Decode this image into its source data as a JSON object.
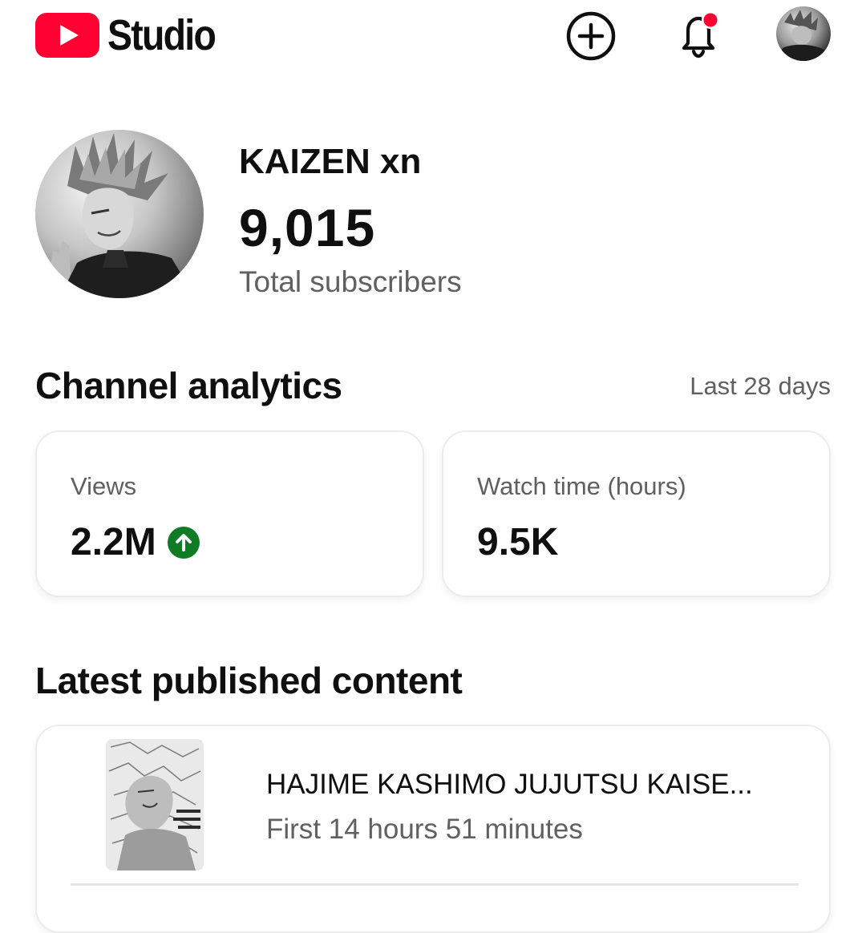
{
  "header": {
    "app_name": "Studio",
    "icons": {
      "logo": "youtube-logo-icon",
      "create": "create-plus-icon",
      "notifications": "notification-bell-icon",
      "account": "account-avatar"
    },
    "has_unread_notifications": true,
    "brand_color": "#ff0000"
  },
  "channel": {
    "name": "KAIZEN xn",
    "subscriber_count": "9,015",
    "subscriber_label": "Total subscribers"
  },
  "analytics": {
    "title": "Channel analytics",
    "period": "Last 28 days",
    "cards": [
      {
        "label": "Views",
        "value": "2.2M",
        "trend": "up",
        "trend_color": "#0f7b24"
      },
      {
        "label": "Watch time (hours)",
        "value": "9.5K"
      }
    ]
  },
  "latest_content": {
    "title": "Latest published content",
    "items": [
      {
        "title": "HAJIME KASHIMO JUJUTSU KAISE...",
        "meta": "First 14 hours 51 minutes"
      }
    ]
  }
}
